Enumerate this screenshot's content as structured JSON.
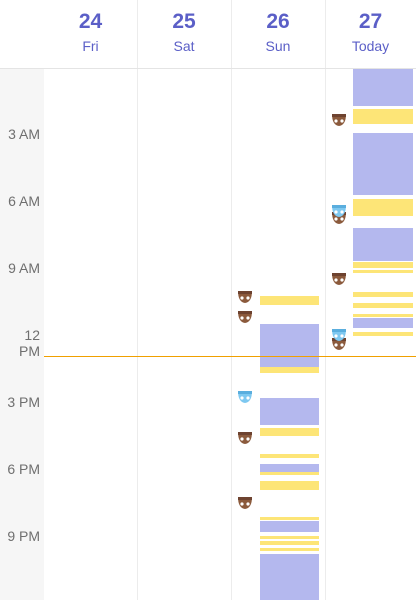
{
  "days": [
    {
      "num": "24",
      "label": "Fri"
    },
    {
      "num": "25",
      "label": "Sat"
    },
    {
      "num": "26",
      "label": "Sun"
    },
    {
      "num": "27",
      "label": "Today"
    }
  ],
  "time_labels": [
    "3 AM",
    "6 AM",
    "9 AM",
    "12 PM",
    "3 PM",
    "6 PM",
    "9 PM"
  ],
  "colors": {
    "accent": "#5b5fc7",
    "sleep_block": "#b4b8ee",
    "feeding_bar": "#fde577",
    "now_line": "#f0a000",
    "diaper_dirty": "#8b5a3c",
    "diaper_wet": "#7ec8f0"
  },
  "icons": {
    "dirty_diaper": "dirty-diaper-icon",
    "wet_diaper": "wet-diaper-icon"
  }
}
